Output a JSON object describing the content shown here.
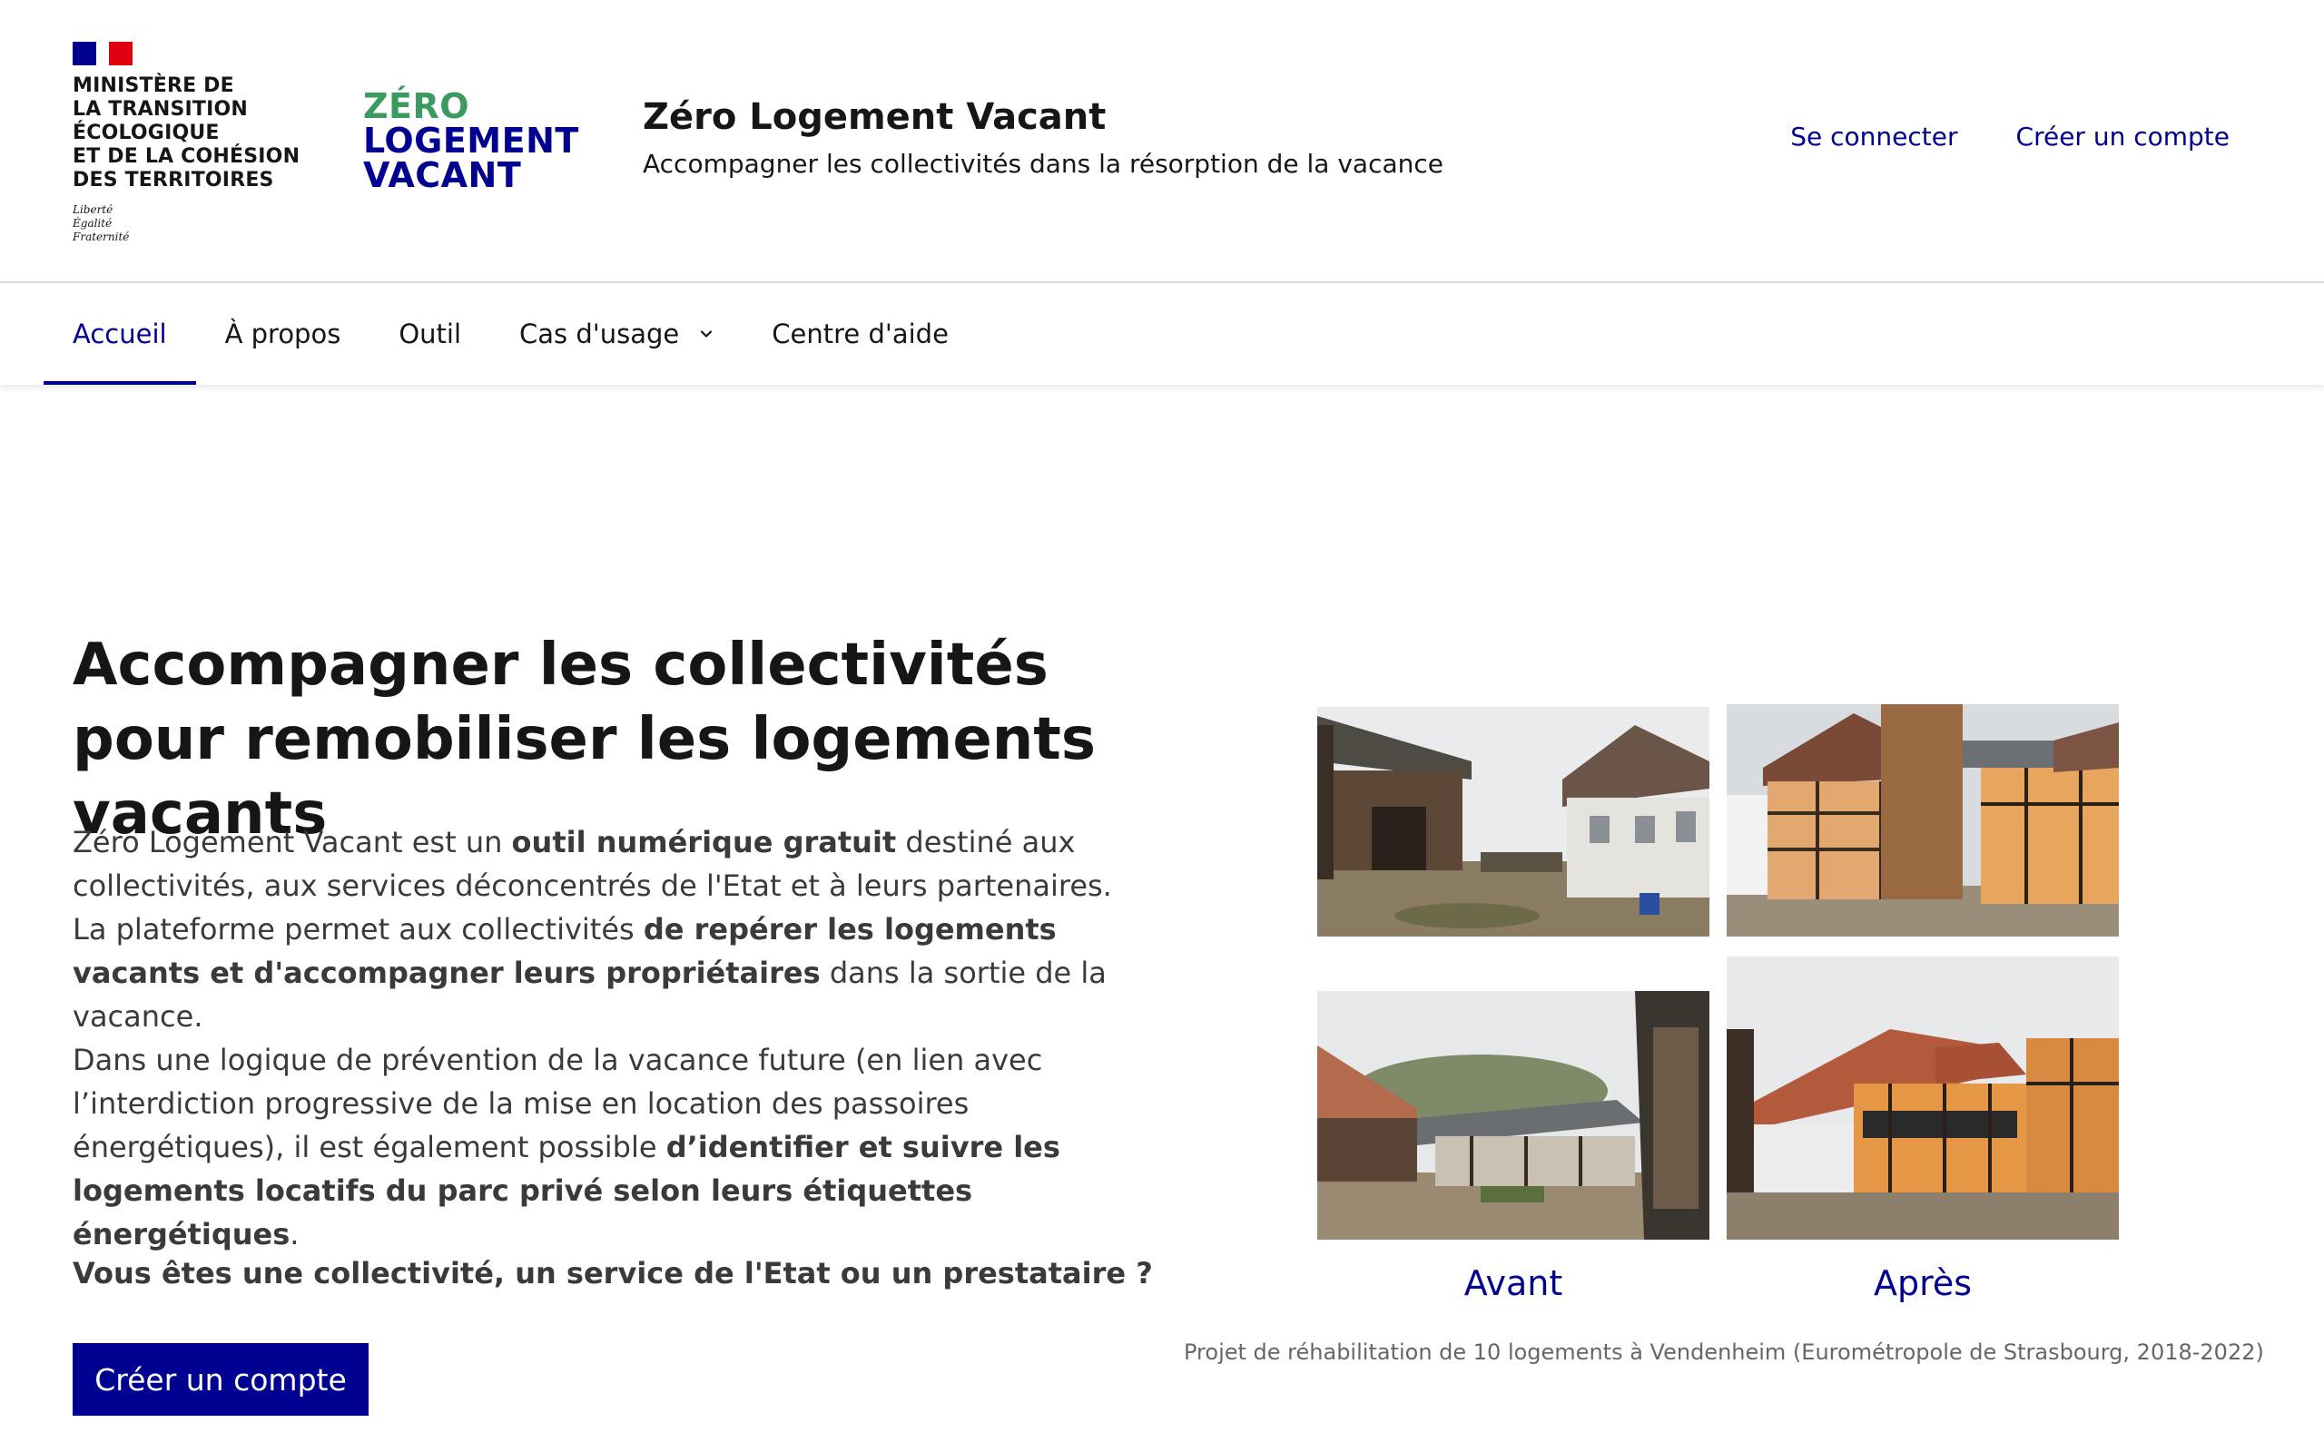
{
  "header": {
    "ministry_lines": [
      "MINISTÈRE DE",
      "LA TRANSITION",
      "ÉCOLOGIQUE",
      "ET DE LA COHÉSION",
      "DES TERRITOIRES"
    ],
    "motto_lines": [
      "Liberté",
      "Égalité",
      "Fraternité"
    ],
    "logo_lines": [
      "ZÉRO",
      "LOGEMENT",
      "VACANT"
    ],
    "site_title": "Zéro Logement Vacant",
    "site_tagline": "Accompagner les collectivités dans la résorption de la vacance",
    "login_label": "Se connecter",
    "signup_label": "Créer un compte"
  },
  "nav": {
    "items": [
      {
        "label": "Accueil",
        "active": true
      },
      {
        "label": "À propos"
      },
      {
        "label": "Outil"
      },
      {
        "label": "Cas d'usage",
        "has_dropdown": true
      },
      {
        "label": "Centre d'aide"
      }
    ]
  },
  "hero": {
    "title": "Accompagner les collectivités pour remobiliser les logements vacants",
    "p1": {
      "t1": "Zéro Logement Vacant est un ",
      "b1": "outil numérique gratuit",
      "t2": " destiné aux collectivités, aux services déconcentrés de l'Etat et à leurs partenaires.",
      "t3": "La plateforme permet aux collectivités ",
      "b2": "de repérer les logements vacants et d'accompagner leurs propriétaires",
      "t4": " dans la sortie de la vacance."
    },
    "p2": {
      "t1": "Dans une logique de prévention de la vacance future (en lien avec l’interdiction progressive de la mise en location des passoires énergétiques), il est également possible ",
      "b1": "d’identifier et suivre les logements locatifs du parc privé selon leurs étiquettes énergétiques",
      "t2": "."
    },
    "question": "Vous êtes une collectivité, un service de l'Etat ou un prestataire ?",
    "cta_label": "Créer un compte"
  },
  "gallery": {
    "label_before": "Avant",
    "label_after": "Après",
    "caption": "Projet de réhabilitation de 10 logements à Vendenheim (Eurométropole de Strasbourg, 2018-2022)"
  }
}
